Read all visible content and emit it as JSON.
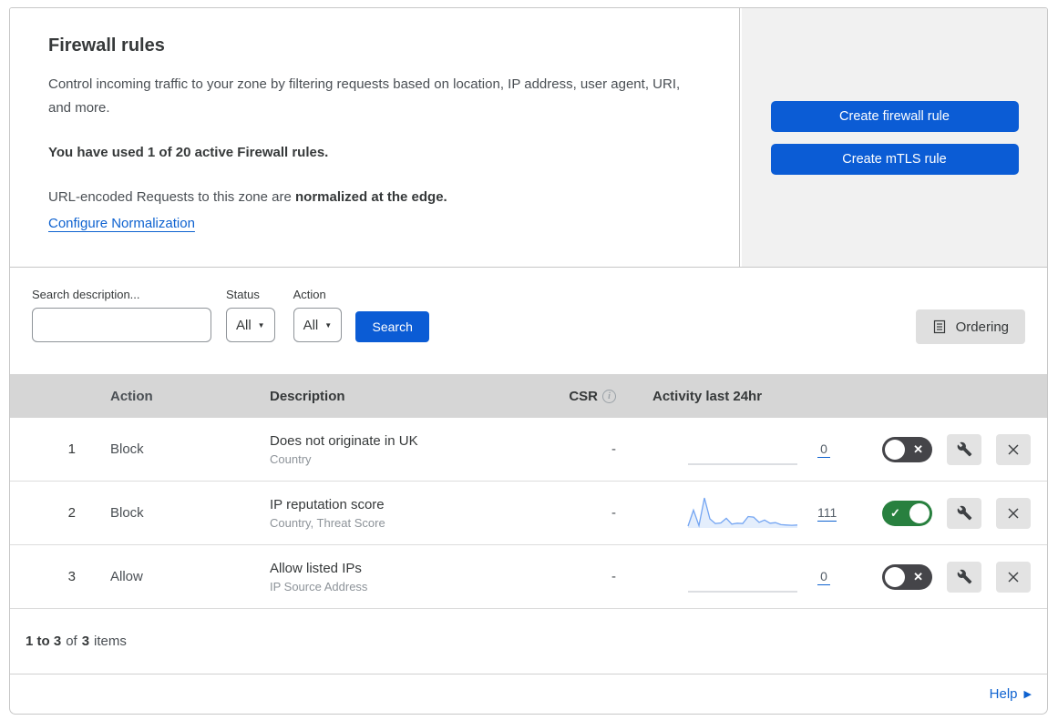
{
  "header": {
    "title": "Firewall rules",
    "description": "Control incoming traffic to your zone by filtering requests based on location, IP address, user agent, URI, and more.",
    "usage": "You have used 1 of 20 active Firewall rules.",
    "normalization_text": "URL-encoded Requests to this zone are ",
    "normalization_bold": "normalized at the edge.",
    "normalization_link": "Configure Normalization",
    "buttons": [
      {
        "label": "Create firewall rule"
      },
      {
        "label": "Create mTLS rule"
      }
    ]
  },
  "filters": {
    "search_label": "Search description...",
    "search_value": "",
    "status_label": "Status",
    "status_value": "All",
    "action_label": "Action",
    "action_value": "All",
    "search_button": "Search",
    "ordering_button": "Ordering"
  },
  "table": {
    "columns": {
      "action": "Action",
      "description": "Description",
      "csr": "CSR",
      "activity": "Activity last 24hr"
    },
    "rows": [
      {
        "number": "1",
        "action": "Block",
        "description": "Does not originate in UK",
        "criteria": "Country",
        "csr": "-",
        "activity_count": "0",
        "enabled": false,
        "sparkline": []
      },
      {
        "number": "2",
        "action": "Block",
        "description": "IP reputation score",
        "criteria": "Country, Threat Score",
        "csr": "-",
        "activity_count": "111",
        "enabled": true,
        "sparkline": [
          3,
          58,
          5,
          100,
          28,
          12,
          14,
          30,
          10,
          13,
          12,
          36,
          34,
          16,
          24,
          13,
          15,
          8,
          7,
          6,
          7
        ]
      },
      {
        "number": "3",
        "action": "Allow",
        "description": "Allow listed IPs",
        "criteria": "IP Source Address",
        "csr": "-",
        "activity_count": "0",
        "enabled": false,
        "sparkline": []
      }
    ]
  },
  "footer": {
    "range_bold": "1 to 3",
    "of_text": "of",
    "total_bold": "3",
    "items_text": "items",
    "help_label": "Help"
  },
  "colors": {
    "button_blue": "#0b5cd5",
    "link_blue": "#0e62d0",
    "toggle_on_green": "#28803f",
    "toggle_off_gray": "#454549",
    "sparkline_stroke": "#74a5f2",
    "sparkline_fill": "#e4eefc",
    "flatline_gray": "#c6cbd1",
    "table_header_gray": "#d6d6d6",
    "cta_panel_gray": "#f1f1f1"
  }
}
